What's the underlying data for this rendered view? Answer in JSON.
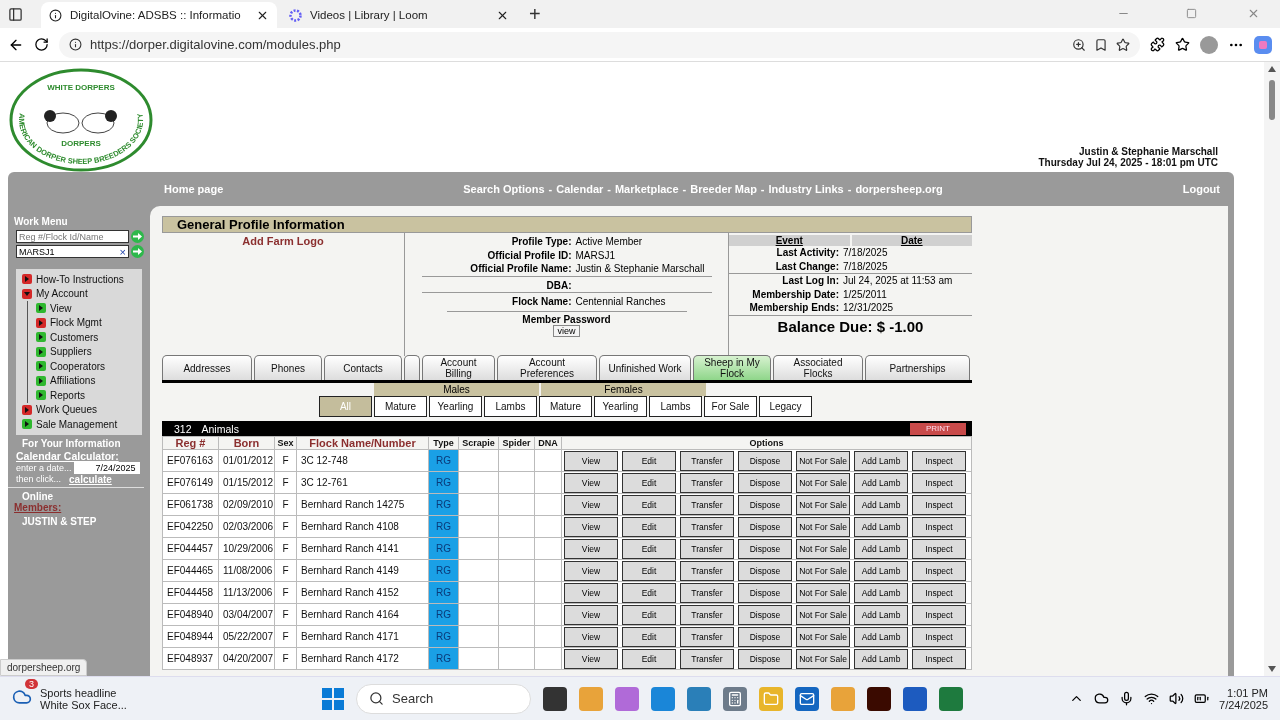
{
  "browser": {
    "tabs": [
      {
        "title": "DigitalOvine: ADSBS :: Informatio",
        "selected": true
      },
      {
        "title": "Videos | Library | Loom",
        "selected": false
      }
    ],
    "new_tab": "+",
    "url": "https://dorper.digitalovine.com/modules.php"
  },
  "logo": {
    "ring_text": "AMERICAN DORPER SHEEP BREEDERS SOCIETY",
    "top_text": "WHITE DORPERS",
    "bottom_text": "DORPERS"
  },
  "user": {
    "name": "Justin & Stephanie Marschall",
    "datetime": "Thursday Jul 24, 2025 - 18:01 pm UTC"
  },
  "nav": {
    "home": "Home page",
    "separator": "-",
    "links": [
      "Search Options",
      "Calendar",
      "Marketplace",
      "Breeder Map",
      "Industry Links",
      "dorpersheep.org"
    ],
    "logout": "Logout"
  },
  "sidebar": {
    "title": "Work Menu",
    "search_placeholder": "Reg #/Flock Id/Name",
    "lookup_value": "MARSJ1",
    "clear": "×",
    "menu": [
      {
        "label": "How-To Instructions",
        "kind": "folder",
        "expanded": false
      },
      {
        "label": "My Account",
        "kind": "folder",
        "expanded": true,
        "children": [
          {
            "label": "View",
            "kind": "leaf"
          },
          {
            "label": "Flock Mgmt",
            "kind": "folder",
            "expanded": false
          },
          {
            "label": "Customers",
            "kind": "leaf"
          },
          {
            "label": "Suppliers",
            "kind": "leaf"
          },
          {
            "label": "Cooperators",
            "kind": "leaf"
          },
          {
            "label": "Affiliations",
            "kind": "leaf"
          },
          {
            "label": "Reports",
            "kind": "leaf"
          }
        ]
      },
      {
        "label": "Work Queues",
        "kind": "folder",
        "expanded": false
      },
      {
        "label": "Sale Management",
        "kind": "leaf"
      }
    ],
    "info_title": "For Your Information",
    "calc_title": "Calendar Calculator:",
    "calc_hint": "enter a date...",
    "calc_date": "7/24/2025",
    "calc_then": "then click...",
    "calc_link": "calculate",
    "online_title": "Online",
    "members_link": "Members:",
    "online_members": [
      "JUSTIN & STEP"
    ]
  },
  "profile": {
    "title": "General Profile Information",
    "logo_link": "Add Farm Logo",
    "fields": [
      {
        "label": "Profile Type:",
        "value": "Active Member",
        "divider": false
      },
      {
        "label": "Official Profile ID:",
        "value": "MARSJ1",
        "divider": false
      },
      {
        "label": "Official Profile Name:",
        "value": "Justin & Stephanie Marschall",
        "divider": false
      },
      {
        "label": "DBA:",
        "divider": true
      },
      {
        "label": "Flock Name:",
        "value": "Centennial Ranches",
        "divider": true
      }
    ],
    "password_label": "Member Password",
    "password_button": "view",
    "event_headers": [
      "Event",
      "Date"
    ],
    "events": [
      {
        "label": "Last Activity:",
        "value": "7/18/2025",
        "divider": false
      },
      {
        "label": "Last Change:",
        "value": "7/18/2025",
        "divider": true
      },
      {
        "label": "Last Log In:",
        "value": "Jul 24, 2025 at 11:53 am",
        "divider": false
      },
      {
        "label": "Membership Date:",
        "value": "1/25/2011",
        "divider": false
      },
      {
        "label": "Membership Ends:",
        "value": "12/31/2025",
        "divider": true
      }
    ],
    "balance": "Balance Due: $ -1.00"
  },
  "tabs": [
    {
      "kind": "tab",
      "label": "Addresses",
      "selected": false
    },
    {
      "kind": "tab",
      "label": "Phones",
      "selected": false
    },
    {
      "kind": "tab",
      "label": "Contacts",
      "selected": false
    },
    {
      "kind": "blank",
      "selected": false
    },
    {
      "kind": "tab",
      "label": "Account Billing",
      "selected": false
    },
    {
      "kind": "tab",
      "label": "Account Preferences",
      "selected": false
    },
    {
      "kind": "tab",
      "label": "Unfinished Work",
      "selected": false
    },
    {
      "kind": "tab",
      "label": "Sheep in My Flock",
      "selected": true
    },
    {
      "kind": "tab",
      "label": "Associated Flocks",
      "selected": false
    },
    {
      "kind": "tab",
      "label": "Partnerships",
      "selected": false
    }
  ],
  "filter_groups": [
    "Males",
    "Females"
  ],
  "filters": [
    {
      "label": "All",
      "selected": true
    },
    {
      "label": "Mature",
      "selected": false
    },
    {
      "label": "Yearling",
      "selected": false
    },
    {
      "label": "Lambs",
      "selected": false
    },
    {
      "label": "Mature",
      "selected": false
    },
    {
      "label": "Yearling",
      "selected": false
    },
    {
      "label": "Lambs",
      "selected": false
    },
    {
      "label": "For Sale",
      "selected": false
    },
    {
      "label": "Legacy",
      "selected": false
    }
  ],
  "animals": {
    "count": "312",
    "count_label": "Animals",
    "print": "PRINT",
    "columns": [
      "Reg #",
      "Born",
      "Sex",
      "Flock Name/Number",
      "Type",
      "Scrapie",
      "Spider",
      "DNA",
      "Options"
    ],
    "rows": [
      {
        "reg": "EF076163",
        "born": "01/01/2012",
        "sex": "F",
        "flock": "3C 12-748",
        "type": "RG",
        "actions": [
          "View",
          "Edit",
          "Transfer",
          "Dispose",
          "Not For Sale",
          "Add Lamb",
          "Inspect"
        ]
      },
      {
        "reg": "EF076149",
        "born": "01/15/2012",
        "sex": "F",
        "flock": "3C 12-761",
        "type": "RG",
        "actions": [
          "View",
          "Edit",
          "Transfer",
          "Dispose",
          "Not For Sale",
          "Add Lamb",
          "Inspect"
        ]
      },
      {
        "reg": "EF061738",
        "born": "02/09/2010",
        "sex": "F",
        "flock": "Bernhard Ranch 14275",
        "type": "RG",
        "actions": [
          "View",
          "Edit",
          "Transfer",
          "Dispose",
          "Not For Sale",
          "Add Lamb",
          "Inspect"
        ]
      },
      {
        "reg": "EF042250",
        "born": "02/03/2006",
        "sex": "F",
        "flock": "Bernhard Ranch 4108",
        "type": "RG",
        "actions": [
          "View",
          "Edit",
          "Transfer",
          "Dispose",
          "Not For Sale",
          "Add Lamb",
          "Inspect"
        ]
      },
      {
        "reg": "EF044457",
        "born": "10/29/2006",
        "sex": "F",
        "flock": "Bernhard Ranch 4141",
        "type": "RG",
        "actions": [
          "View",
          "Edit",
          "Transfer",
          "Dispose",
          "Not For Sale",
          "Add Lamb",
          "Inspect"
        ]
      },
      {
        "reg": "EF044465",
        "born": "11/08/2006",
        "sex": "F",
        "flock": "Bernhard Ranch 4149",
        "type": "RG",
        "actions": [
          "View",
          "Edit",
          "Transfer",
          "Dispose",
          "Not For Sale",
          "Add Lamb",
          "Inspect"
        ]
      },
      {
        "reg": "EF044458",
        "born": "11/13/2006",
        "sex": "F",
        "flock": "Bernhard Ranch 4152",
        "type": "RG",
        "actions": [
          "View",
          "Edit",
          "Transfer",
          "Dispose",
          "Not For Sale",
          "Add Lamb",
          "Inspect"
        ]
      },
      {
        "reg": "EF048940",
        "born": "03/04/2007",
        "sex": "F",
        "flock": "Bernhard Ranch 4164",
        "type": "RG",
        "actions": [
          "View",
          "Edit",
          "Transfer",
          "Dispose",
          "Not For Sale",
          "Add Lamb",
          "Inspect"
        ]
      },
      {
        "reg": "EF048944",
        "born": "05/22/2007",
        "sex": "F",
        "flock": "Bernhard Ranch 4171",
        "type": "RG",
        "actions": [
          "View",
          "Edit",
          "Transfer",
          "Dispose",
          "Not For Sale",
          "Add Lamb",
          "Inspect"
        ]
      },
      {
        "reg": "EF048937",
        "born": "04/20/2007",
        "sex": "F",
        "flock": "Bernhard Ranch 4172",
        "type": "RG",
        "actions": [
          "View",
          "Edit",
          "Transfer",
          "Dispose",
          "Not For Sale",
          "Add Lamb",
          "Inspect"
        ]
      }
    ]
  },
  "status_link": "dorpersheep.org",
  "taskbar": {
    "news_badge": "3",
    "news_title": "Sports headline",
    "news_text": "White Sox Face...",
    "search": "Search",
    "time": "1:01 PM",
    "date": "7/24/2025"
  }
}
